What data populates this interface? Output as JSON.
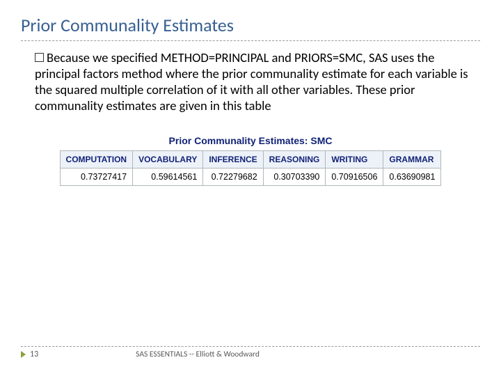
{
  "title": "Prior Communality Estimates",
  "body": "Because we specified METHOD=PRINCIPAL and PRIORS=SMC, SAS uses the principal factors method where the prior communality estimate for each variable is the squared multiple correlation of it with all other variables. These prior communality estimates are given  in this table",
  "table": {
    "caption": "Prior Communality Estimates: SMC",
    "headers": [
      "COMPUTATION",
      "VOCABULARY",
      "INFERENCE",
      "REASONING",
      "WRITING",
      "GRAMMAR"
    ],
    "values": [
      "0.73727417",
      "0.59614561",
      "0.72279682",
      "0.30703390",
      "0.70916506",
      "0.63690981"
    ]
  },
  "footer": {
    "page": "13",
    "text": "SAS ESSENTIALS -- Elliott & Woodward"
  },
  "chart_data": {
    "type": "table",
    "title": "Prior Communality Estimates: SMC",
    "columns": [
      "COMPUTATION",
      "VOCABULARY",
      "INFERENCE",
      "REASONING",
      "WRITING",
      "GRAMMAR"
    ],
    "rows": [
      [
        0.73727417,
        0.59614561,
        0.72279682,
        0.3070339,
        0.70916506,
        0.63690981
      ]
    ]
  }
}
